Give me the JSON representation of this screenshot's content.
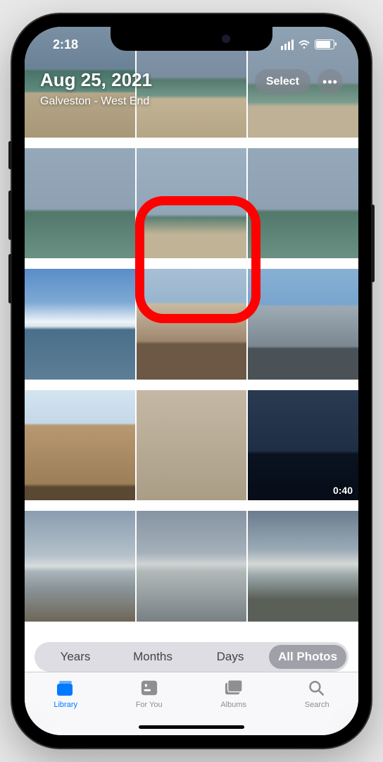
{
  "status": {
    "time": "2:18"
  },
  "header": {
    "date": "Aug 25, 2021",
    "location": "Galveston - West End",
    "select_label": "Select"
  },
  "grid": {
    "video_duration": "0:40"
  },
  "segments": {
    "items": [
      "Years",
      "Months",
      "Days",
      "All Photos"
    ],
    "active_index": 3
  },
  "tabs": {
    "items": [
      {
        "label": "Library",
        "icon": "photo-stack-icon"
      },
      {
        "label": "For You",
        "icon": "foryou-icon"
      },
      {
        "label": "Albums",
        "icon": "albums-icon"
      },
      {
        "label": "Search",
        "icon": "search-icon"
      }
    ],
    "active_index": 0
  }
}
